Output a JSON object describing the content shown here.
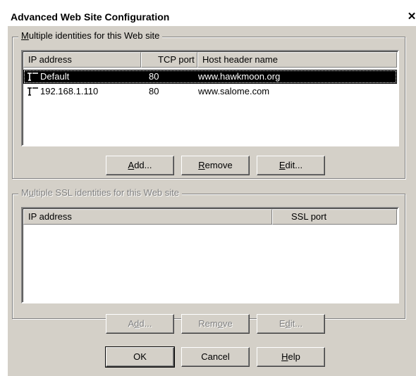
{
  "window": {
    "title": "Advanced Web Site Configuration",
    "close_glyph": "✕"
  },
  "identities": {
    "group_label_pre": "",
    "group_label_mnemonic": "M",
    "group_label_post": "ultiple identities for this Web site",
    "columns": [
      "IP address",
      "TCP port",
      "Host header name"
    ],
    "rows": [
      {
        "ip": "Default",
        "port": "80",
        "host": "www.hawkmoon.org",
        "selected": true,
        "icon": "network-plug-icon"
      },
      {
        "ip": "192.168.1.110",
        "port": "80",
        "host": "www.salome.com",
        "selected": false,
        "icon": "network-plug-icon"
      }
    ],
    "buttons": {
      "add": {
        "pre": "",
        "mn": "A",
        "post": "dd..."
      },
      "remove": {
        "pre": "",
        "mn": "R",
        "post": "emove"
      },
      "edit": {
        "pre": "",
        "mn": "E",
        "post": "dit..."
      }
    }
  },
  "ssl": {
    "group_label_pre": "M",
    "group_label_mnemonic": "u",
    "group_label_post": "ltiple SSL identities for this Web site",
    "columns": [
      "IP address",
      "SSL port"
    ],
    "rows": [],
    "buttons": {
      "add": {
        "pre": "A",
        "mn": "d",
        "post": "d..."
      },
      "remove": {
        "pre": "Rem",
        "mn": "o",
        "post": "ve"
      },
      "edit": {
        "pre": "E",
        "mn": "d",
        "post": "it..."
      }
    }
  },
  "footer": {
    "ok": "OK",
    "cancel": "Cancel",
    "help": {
      "pre": "",
      "mn": "H",
      "post": "elp"
    }
  }
}
